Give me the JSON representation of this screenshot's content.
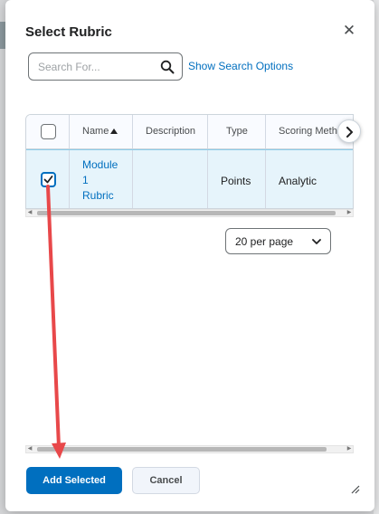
{
  "dialog": {
    "title": "Select Rubric",
    "close_icon": "close-icon"
  },
  "search": {
    "placeholder": "Search For...",
    "value": "",
    "icon": "search-icon",
    "options_link": "Show Search Options"
  },
  "table": {
    "columns": [
      "Name",
      "Description",
      "Type",
      "Scoring Metho"
    ],
    "sort_icon": "sort-ascending-icon",
    "header_checkbox_checked": false,
    "rows": [
      {
        "selected": true,
        "name_lines": [
          "Module",
          "1",
          "Rubric"
        ],
        "description": "",
        "type": "Points",
        "scoring_method": "Analytic"
      }
    ],
    "scroll_right_icon": "chevron-right-icon"
  },
  "pagination": {
    "per_page": "20 per page",
    "icon": "chevron-down-icon"
  },
  "footer": {
    "primary_label": "Add Selected",
    "secondary_label": "Cancel"
  },
  "colors": {
    "primary": "#006fbf",
    "selected_row": "#e6f4fb",
    "annotation_arrow": "#e8484a"
  }
}
